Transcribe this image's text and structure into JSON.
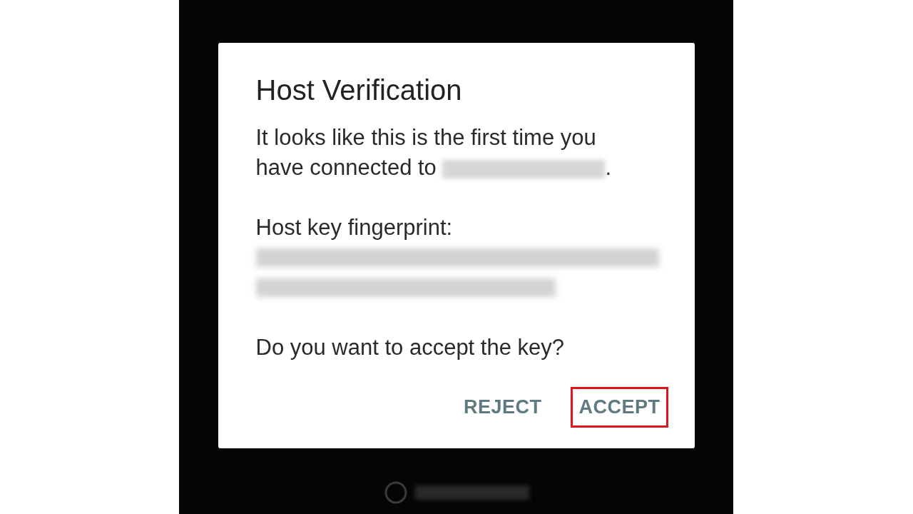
{
  "dialog": {
    "title": "Host Verification",
    "message": {
      "first_line": "It looks like this is the first time you",
      "second_line": "have connected to",
      "end": "."
    },
    "fingerprint_label": "Host key fingerprint:",
    "question": "Do you want to accept the key?",
    "buttons": [
      {
        "label": "REJECT",
        "highlighted": false
      },
      {
        "label": "ACCEPT",
        "highlighted": true
      }
    ]
  }
}
